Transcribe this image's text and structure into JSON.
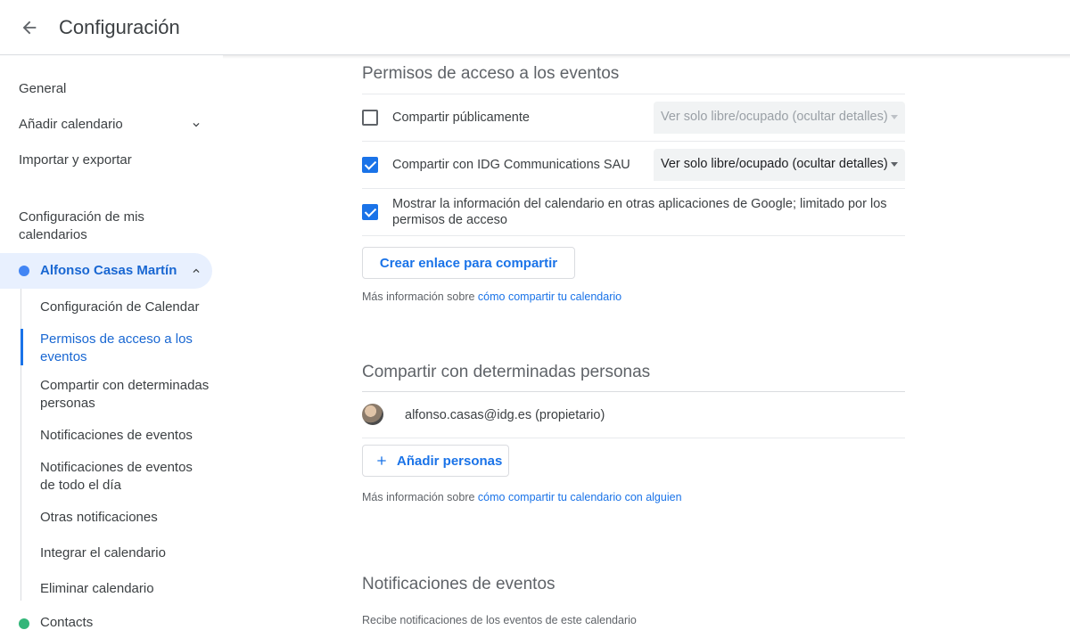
{
  "header": {
    "title": "Configuración"
  },
  "sidebar": {
    "general": "General",
    "add_calendar": "Añadir calendario",
    "import_export": "Importar y exportar",
    "my_calendars_heading": "Configuración de mis calendarios",
    "calendar_name": "Alfonso Casas Martín",
    "sub_items": [
      "Configuración de Calendar",
      "Permisos de acceso a los eventos",
      "Compartir con determinadas personas",
      "Notificaciones de eventos",
      "Notificaciones de eventos de todo el día",
      "Otras notificaciones",
      "Integrar el calendario",
      "Eliminar calendario"
    ],
    "contacts": "Contacts"
  },
  "access": {
    "title": "Permisos de acceso a los eventos",
    "public_label": "Compartir públicamente",
    "public_checked": false,
    "public_select": "Ver solo libre/ocupado (ocultar detalles)",
    "org_label": "Compartir con IDG Communications SAU",
    "org_checked": true,
    "org_select": "Ver solo libre/ocupado (ocultar detalles)",
    "show_info_label": "Mostrar la información del calendario en otras aplicaciones de Google; limitado por los permisos de acceso",
    "show_info_checked": true,
    "create_link_button": "Crear enlace para compartir",
    "help_prefix": "Más información sobre ",
    "help_link": "cómo compartir tu calendario"
  },
  "share": {
    "title": "Compartir con determinadas personas",
    "owner": "alfonso.casas@idg.es (propietario)",
    "add_button": "Añadir personas",
    "help_prefix": "Más información sobre ",
    "help_link": "cómo compartir tu calendario con alguien"
  },
  "notifications": {
    "title": "Notificaciones de eventos",
    "subtitle": "Recibe notificaciones de los eventos de este calendario"
  },
  "colors": {
    "accent": "#1a73e8",
    "selected_bg": "#e8f0fe",
    "calendar_dot": "#4285f4",
    "contacts_dot": "#33b679"
  }
}
